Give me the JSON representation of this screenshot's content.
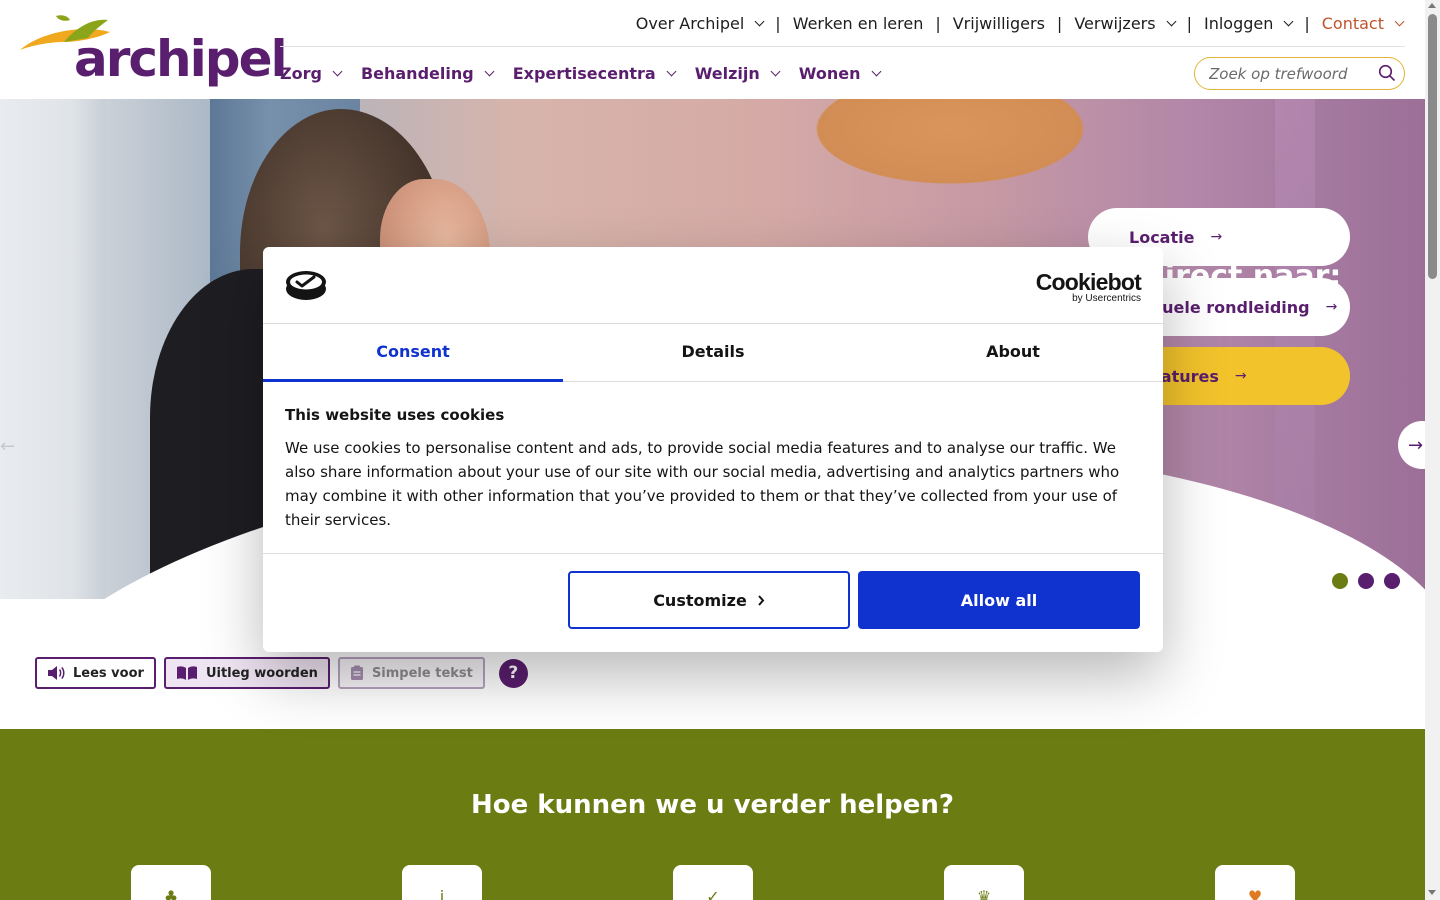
{
  "header": {
    "logo_text": "archipel",
    "top_nav": [
      {
        "label": "Over Archipel",
        "dropdown": true
      },
      {
        "label": "Werken en leren",
        "dropdown": false
      },
      {
        "label": "Vrijwilligers",
        "dropdown": false
      },
      {
        "label": "Verwijzers",
        "dropdown": true
      },
      {
        "label": "Inloggen",
        "dropdown": true
      },
      {
        "label": "Contact",
        "dropdown": true
      }
    ],
    "main_nav": [
      {
        "label": "Zorg"
      },
      {
        "label": "Behandeling"
      },
      {
        "label": "Expertisecentra"
      },
      {
        "label": "Welzijn"
      },
      {
        "label": "Wonen"
      }
    ],
    "search": {
      "placeholder": "Zoek op trefwoord",
      "value": ""
    }
  },
  "hero": {
    "goto_title": "Ga direct naar:",
    "buttons": [
      {
        "label": "Locatie"
      },
      {
        "label": "Virtuele rondleiding"
      },
      {
        "label": "Vacatures"
      }
    ],
    "slides": 3,
    "active_slide": 1
  },
  "read_tools": {
    "read_aloud": "Lees voor",
    "explain_words": "Uitleg woorden",
    "simple_text": "Simpele tekst",
    "help": "?"
  },
  "help_section": {
    "title": "Hoe kunnen we u verder helpen?"
  },
  "cookie_dialog": {
    "brand": "Cookiebot",
    "brand_sub": "by Usercentrics",
    "tabs": [
      {
        "label": "Consent",
        "active": true
      },
      {
        "label": "Details",
        "active": false
      },
      {
        "label": "About",
        "active": false
      }
    ],
    "heading": "This website uses cookies",
    "body": "We use cookies to personalise content and ads, to provide social media features and to analyse our traffic. We also share information about your use of our site with our social media, advertising and analytics partners who may combine it with other information that you’ve provided to them or that they’ve collected from your use of their services.",
    "customize_label": "Customize",
    "allow_all_label": "Allow all"
  },
  "colors": {
    "brand_purple": "#5a1e6e",
    "brand_green": "#6a7c12",
    "brand_yellow": "#f2c32b",
    "contact_orange": "#c0542b",
    "cookiebot_blue": "#1032cf"
  }
}
